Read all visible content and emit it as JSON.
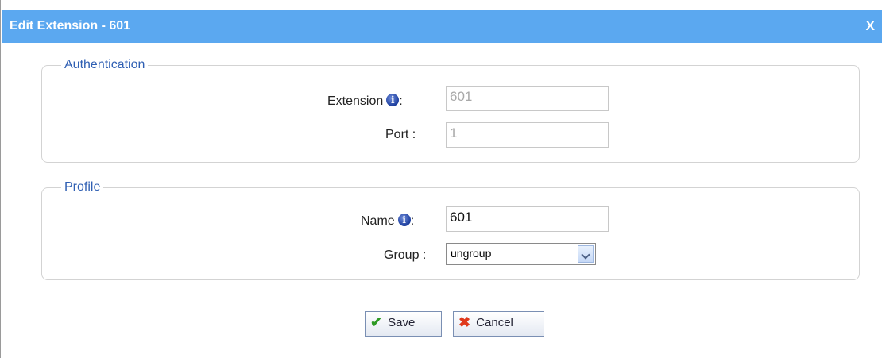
{
  "dialog": {
    "title": "Edit Extension - 601",
    "close_label": "X"
  },
  "authentication": {
    "legend": "Authentication",
    "extension_label": "Extension",
    "extension_colon": ":",
    "extension_value": "601",
    "port_label": "Port :",
    "port_value": "1"
  },
  "profile": {
    "legend": "Profile",
    "name_label": "Name",
    "name_colon": ":",
    "name_value": "601",
    "group_label": "Group :",
    "group_value": "ungroup"
  },
  "buttons": {
    "save_label": "Save",
    "cancel_label": "Cancel"
  },
  "icons": {
    "info": "info-icon",
    "save": "checkmark-icon",
    "cancel": "x-icon",
    "dropdown": "chevron-down-icon"
  },
  "colors": {
    "titlebar": "#5ba8f0",
    "legend": "#2f5fb3"
  }
}
